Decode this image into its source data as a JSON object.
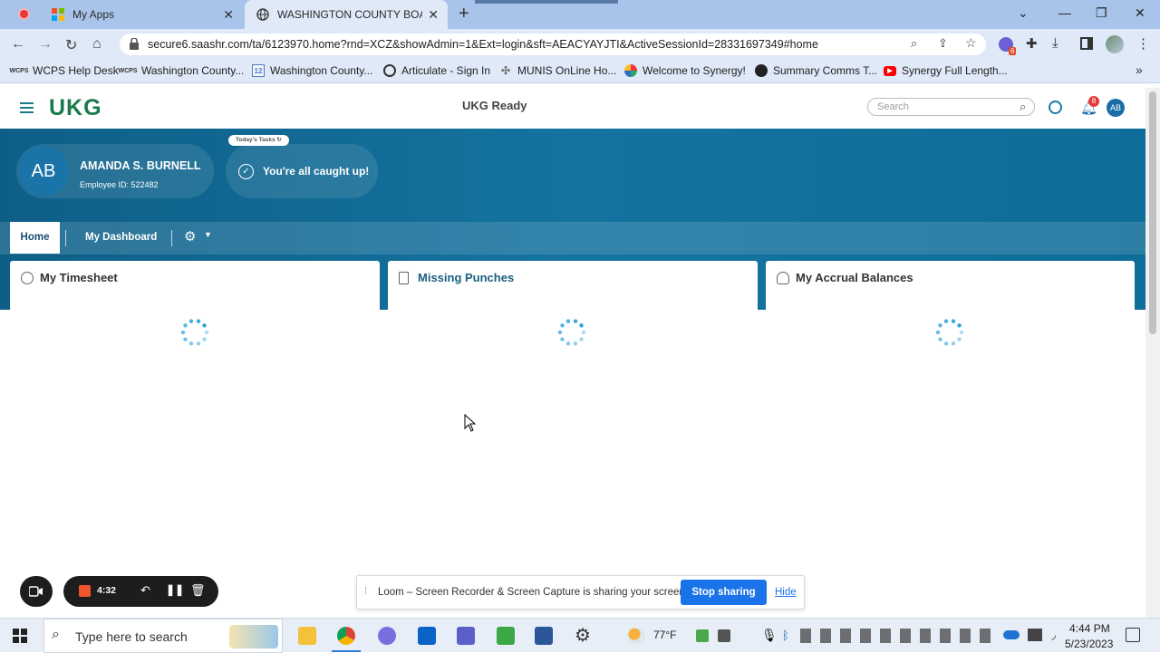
{
  "browser": {
    "tabs": [
      {
        "label": "My Apps",
        "icon": "microsoft-icon"
      },
      {
        "label": "WASHINGTON COUNTY BOARD",
        "icon": "globe-icon"
      }
    ],
    "new_tab": "+",
    "url": "secure6.saashr.com/ta/6123970.home?rnd=XCZ&showAdmin=1&Ext=login&sft=AEACYAYJTI&ActiveSessionId=28331697349#home",
    "extension_badge": "6",
    "bookmarks": [
      {
        "label": "WCPS Help Desk",
        "icon": "wcps-icon"
      },
      {
        "label": "Washington County...",
        "icon": "wcps-icon"
      },
      {
        "label": "Washington County...",
        "icon": "calendar-icon"
      },
      {
        "label": "Articulate - Sign In",
        "icon": "articulate-icon"
      },
      {
        "label": "MUNIS OnLine Ho...",
        "icon": "munis-icon"
      },
      {
        "label": "Welcome to Synergy!",
        "icon": "synergy-icon"
      },
      {
        "label": "Summary Comms T...",
        "icon": "github-icon"
      },
      {
        "label": "Synergy Full Length...",
        "icon": "youtube-icon"
      }
    ],
    "more_bookmarks": "»"
  },
  "app": {
    "logo": "UKG",
    "title": "UKG Ready",
    "search_placeholder": "Search",
    "notification_count": "8",
    "avatar_initials": "AB",
    "brand_color": "#1a7a4c",
    "hero_color": "#0e6690"
  },
  "profile": {
    "initials": "AB",
    "name": "AMANDA S. BURNELL",
    "employee_id": "Employee ID: 522482"
  },
  "tasks": {
    "badge": "Today's Tasks",
    "message": "You're all caught up!"
  },
  "nav": {
    "tabs": [
      "Home",
      "My Dashboard"
    ],
    "active": "Home"
  },
  "cards": [
    {
      "title": "My Timesheet",
      "icon": "clock-icon"
    },
    {
      "title": "Missing Punches",
      "icon": "document-icon"
    },
    {
      "title": "My Accrual Balances",
      "icon": "accrual-icon"
    }
  ],
  "loom": {
    "timer": "4:32",
    "banner_text": "Loom – Screen Recorder & Screen Capture is sharing your screen.",
    "stop_button": "Stop sharing",
    "hide_link": "Hide"
  },
  "taskbar": {
    "search_placeholder": "Type here to search",
    "weather": "77°F",
    "time": "4:44 PM",
    "date": "5/23/2023"
  }
}
